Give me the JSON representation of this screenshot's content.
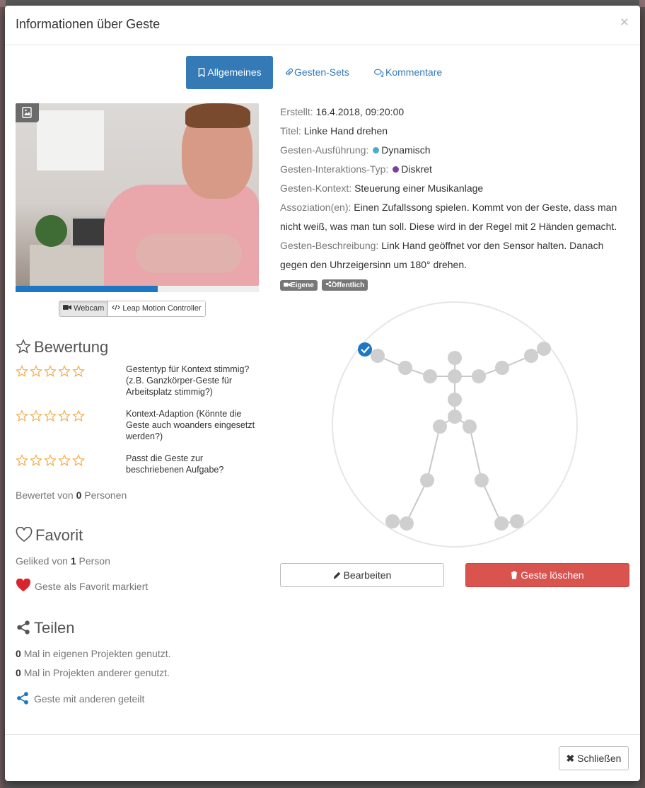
{
  "modal": {
    "title": "Informationen über Geste",
    "close_glyph": "×"
  },
  "tabs": [
    {
      "label": "Allgemeines",
      "icon": "bookmark-icon",
      "active": true
    },
    {
      "label": "Gesten-Sets",
      "icon": "paperclip-icon",
      "active": false
    },
    {
      "label": "Kommentare",
      "icon": "comments-icon",
      "active": false
    }
  ],
  "video": {
    "progress": 0.585,
    "sources": [
      {
        "label": "Webcam",
        "icon": "video-camera-icon",
        "active": true
      },
      {
        "label": "Leap Motion Controller",
        "icon": "code-icon",
        "active": false
      }
    ]
  },
  "rating": {
    "title": "Bewertung",
    "items": [
      {
        "stars": 0,
        "max": 5,
        "text": "Gestentyp für Kontext stimmig? (z.B. Ganzkörper-Geste für Arbeitsplatz stimmig?)"
      },
      {
        "stars": 0,
        "max": 5,
        "text": "Kontext-Adaption (Könnte die Geste auch woanders eingesetzt werden?)"
      },
      {
        "stars": 0,
        "max": 5,
        "text": "Passt die Geste zur beschriebenen Aufgabe?"
      }
    ],
    "rated_prefix": "Bewertet von",
    "rated_count": "0",
    "rated_suffix": "Personen"
  },
  "favorite": {
    "title": "Favorit",
    "liked_prefix": "Geliked von",
    "liked_count": "1",
    "liked_suffix": "Person",
    "mark_label": "Geste als Favorit markiert",
    "heart_color": "#d9232e"
  },
  "share": {
    "title": "Teilen",
    "own_count": "0",
    "own_text": "Mal in eigenen Projekten genutzt.",
    "other_count": "0",
    "other_text": "Mal in Projekten anderer genutzt.",
    "shared_label": "Geste mit anderen geteilt",
    "icon_color": "#1d77c2"
  },
  "meta": {
    "created_label": "Erstellt:",
    "created_value": "16.4.2018, 09:20:00",
    "title_label": "Titel:",
    "title_value": "Linke Hand drehen",
    "execution_label": "Gesten-Ausführung:",
    "execution_value": "Dynamisch",
    "execution_color": "#4aaccc",
    "interaction_label": "Gesten-Interaktions-Typ:",
    "interaction_value": "Diskret",
    "interaction_color": "#7b3fa0",
    "context_label": "Gesten-Kontext:",
    "context_value": "Steuerung einer Musikanlage",
    "association_label": "Assoziation(en):",
    "association_value": "Einen Zufallssong spielen. Kommt von der Geste, dass man nicht weiß, was man tun soll. Diese wird in der Regel mit 2 Händen gemacht.",
    "description_label": "Gesten-Beschreibung:",
    "description_value": "Link Hand geöffnet vor den Sensor halten. Danach gegen den Uhrzeigersinn um 180° drehen."
  },
  "tags": [
    {
      "label": "Eigene",
      "icon": "video-camera-icon"
    },
    {
      "label": "Öffentlich",
      "icon": "share-icon"
    }
  ],
  "actions": {
    "edit_label": "Bearbeiten",
    "delete_label": "Geste löschen",
    "close_label": "Schließen"
  },
  "colors": {
    "primary": "#337ab7",
    "danger": "#d9534f",
    "star": "#f0ad4e"
  }
}
